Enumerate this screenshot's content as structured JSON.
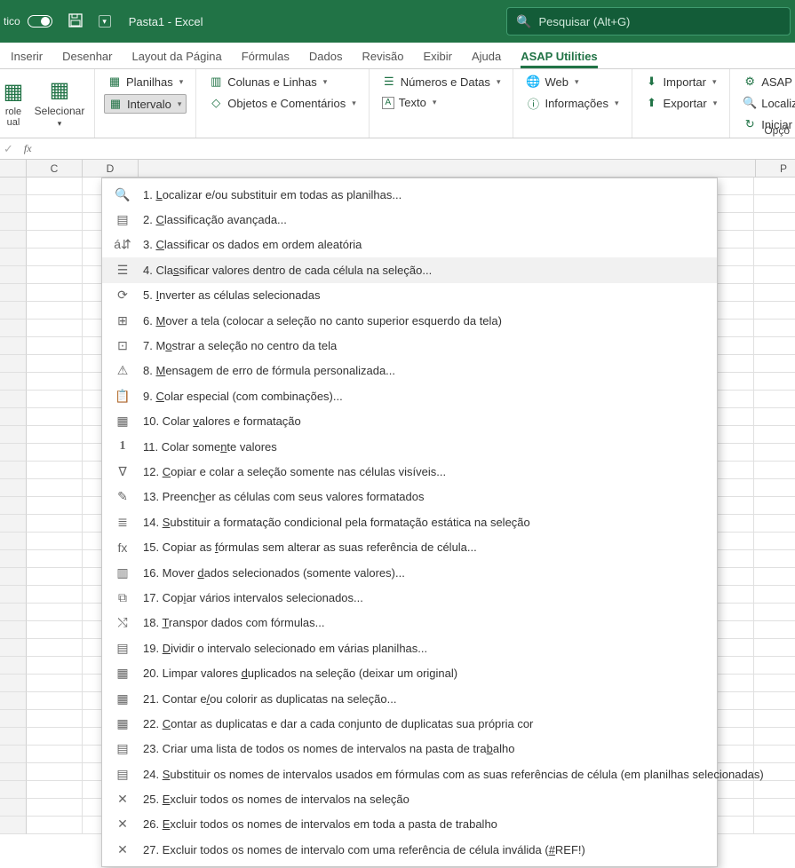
{
  "titlebar": {
    "autosave": "tico",
    "doc_title": "Pasta1  -  Excel",
    "search_placeholder": "Pesquisar (Alt+G)"
  },
  "tabs": {
    "items": [
      "Inserir",
      "Desenhar",
      "Layout da Página",
      "Fórmulas",
      "Dados",
      "Revisão",
      "Exibir",
      "Ajuda",
      "ASAP Utilities"
    ]
  },
  "ribbon": {
    "big1": "role ual",
    "big2": "Selecionar",
    "planilhas": "Planilhas",
    "intervalo": "Intervalo",
    "colunas": "Colunas e Linhas",
    "objetos": "Objetos e Comentários",
    "numeros": "Números e Datas",
    "texto": "Texto",
    "web": "Web",
    "info": "Informações",
    "importar": "Importar",
    "exportar": "Exportar",
    "asap": "ASAP Utilitie",
    "localizar": "Localizar e s",
    "iniciar": "Iniciar a últim",
    "opcoes": "Opçõ"
  },
  "columns": [
    "C",
    "D",
    "",
    "",
    "",
    "",
    "",
    "",
    "",
    "",
    "",
    "P"
  ],
  "menu": {
    "items": [
      {
        "n": "1.",
        "t": "Localizar e/ou substituir em todas as planilhas...",
        "u": "L"
      },
      {
        "n": "2.",
        "t": "Classificação avançada...",
        "u": "C"
      },
      {
        "n": "3.",
        "t": "Classificar os dados em ordem aleatória",
        "u": "C"
      },
      {
        "n": "4.",
        "t": "Classificar valores dentro de cada célula na seleção...",
        "u": "s"
      },
      {
        "n": "5.",
        "t": "Inverter as células selecionadas",
        "u": "I"
      },
      {
        "n": "6.",
        "t": "Mover a tela (colocar a seleção no canto superior esquerdo da tela)",
        "u": "M"
      },
      {
        "n": "7.",
        "t": "Mostrar a seleção no centro da tela",
        "u": "o"
      },
      {
        "n": "8.",
        "t": "Mensagem de erro de fórmula personalizada...",
        "u": "M"
      },
      {
        "n": "9.",
        "t": "Colar especial (com combinações)...",
        "u": "C"
      },
      {
        "n": "10.",
        "t": "Colar valores e formatação",
        "u": "v"
      },
      {
        "n": "11.",
        "t": "Colar somente valores",
        "u": "n"
      },
      {
        "n": "12.",
        "t": "Copiar e colar a seleção somente nas células visíveis...",
        "u": "C"
      },
      {
        "n": "13.",
        "t": "Preencher as células com seus valores formatados",
        "u": "h"
      },
      {
        "n": "14.",
        "t": "Substituir a formatação condicional pela formatação estática na seleção",
        "u": "S"
      },
      {
        "n": "15.",
        "t": "Copiar as fórmulas sem alterar as suas referência de célula...",
        "u": "f"
      },
      {
        "n": "16.",
        "t": "Mover dados selecionados (somente valores)...",
        "u": "d"
      },
      {
        "n": "17.",
        "t": "Copiar vários intervalos selecionados...",
        "u": "i"
      },
      {
        "n": "18.",
        "t": "Transpor dados com fórmulas...",
        "u": "T"
      },
      {
        "n": "19.",
        "t": "Dividir o intervalo selecionado em várias planilhas...",
        "u": "D"
      },
      {
        "n": "20.",
        "t": "Limpar valores duplicados na seleção (deixar um original)",
        "u": "d"
      },
      {
        "n": "21.",
        "t": "Contar e/ou colorir as duplicatas na seleção...",
        "u": "/"
      },
      {
        "n": "22.",
        "t": "Contar as duplicatas e dar a cada conjunto de duplicatas sua própria cor",
        "u": "C"
      },
      {
        "n": "23.",
        "t": "Criar uma lista de todos os nomes de intervalos na pasta de trabalho",
        "u": "b"
      },
      {
        "n": "24.",
        "t": "Substituir os nomes de intervalos usados em fórmulas com as suas referências de célula (em planilhas selecionadas)",
        "u": "S"
      },
      {
        "n": "25.",
        "t": "Excluir todos os nomes de intervalos na seleção",
        "u": "E"
      },
      {
        "n": "26.",
        "t": "Excluir todos os nomes de intervalos em toda a pasta de trabalho",
        "u": "E"
      },
      {
        "n": "27.",
        "t": "Excluir todos os nomes de intervalo com uma referência de célula inválida (#REF!)",
        "u": "#"
      }
    ]
  }
}
